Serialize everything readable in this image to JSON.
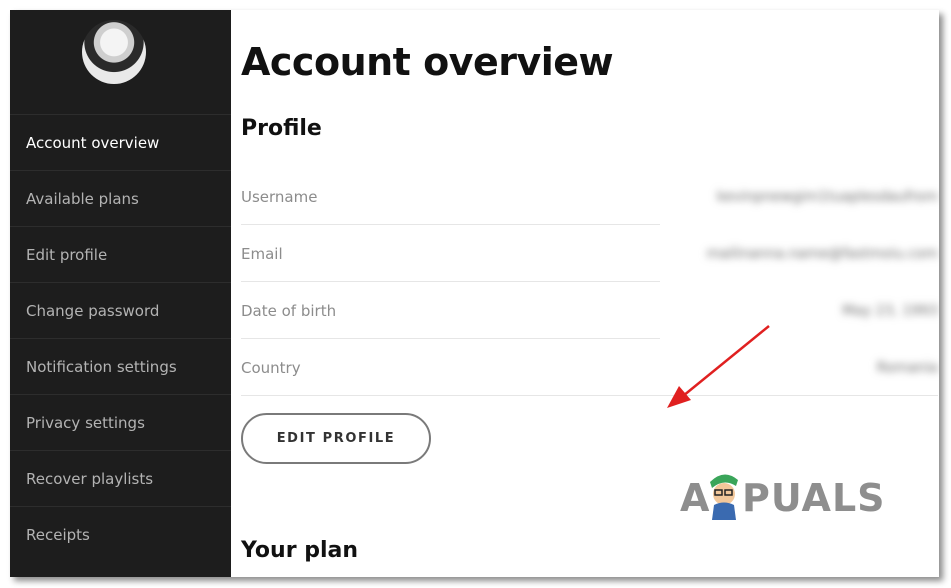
{
  "sidebar": {
    "items": [
      {
        "label": "Account overview",
        "active": true
      },
      {
        "label": "Available plans"
      },
      {
        "label": "Edit profile"
      },
      {
        "label": "Change password"
      },
      {
        "label": "Notification settings"
      },
      {
        "label": "Privacy settings"
      },
      {
        "label": "Recover playlists"
      },
      {
        "label": "Receipts"
      }
    ]
  },
  "main": {
    "title": "Account overview",
    "profile": {
      "heading": "Profile",
      "fields": [
        {
          "label": "Username",
          "value": "kevinpnewgim1tuaplesdaufrom"
        },
        {
          "label": "Email",
          "value": "mailinanna.name@fastmoiu.com"
        },
        {
          "label": "Date of birth",
          "value": "May 23, 1993"
        },
        {
          "label": "Country",
          "value": "Romania"
        }
      ],
      "edit_button": "EDIT PROFILE"
    },
    "plan": {
      "heading": "Your plan"
    }
  },
  "watermark": {
    "text_a": "A",
    "text_b": "PUALS"
  },
  "colors": {
    "sidebar_bg": "#1d1d1d",
    "arrow": "#e02020",
    "active_text": "#ffffff",
    "inactive_text": "#b3b3b3"
  }
}
